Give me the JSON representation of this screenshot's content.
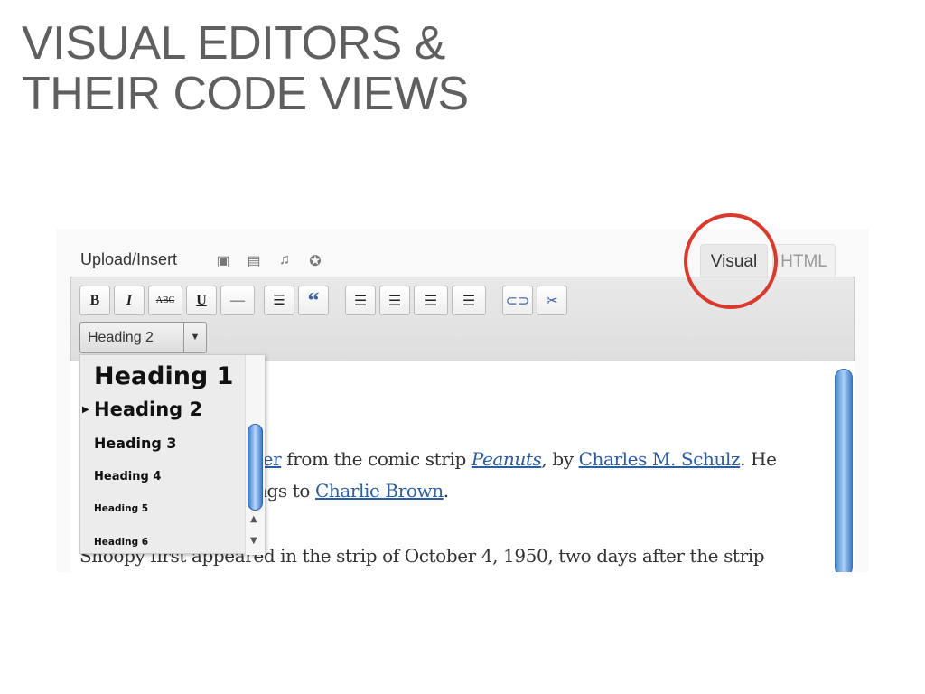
{
  "slide": {
    "title_line1": "VISUAL EDITORS &",
    "title_line2": "THEIR CODE VIEWS"
  },
  "editor": {
    "upload_label": "Upload/Insert",
    "upload_icons": [
      "image-icon",
      "gallery-icon",
      "music-icon",
      "media-icon"
    ],
    "tabs": [
      {
        "label": "Visual",
        "active": true
      },
      {
        "label": "HTML",
        "active": false
      }
    ],
    "toolbar": {
      "bold": "B",
      "italic": "I",
      "strike": "ABC",
      "underline": "U",
      "hr": "—",
      "quote": "“"
    },
    "format_select": {
      "value": "Heading 2"
    },
    "format_options": [
      "Heading 1",
      "Heading 2",
      "Heading 3",
      "Heading 4",
      "Heading 5",
      "Heading 6"
    ],
    "content": {
      "l1_a": "ter",
      "l1_b": " from the comic strip ",
      "l1_c": "Peanuts",
      "l1_d": ", by ",
      "l1_e": "Charles M. Schulz",
      "l1_f": ". He",
      "l2_a": "ngs to ",
      "l2_b": "Charlie Brown",
      "l2_c": ".",
      "l3": "Snoopy first appeared in the strip of October 4, 1950, two days after the strip"
    },
    "highlight_color": "#d83a2e"
  }
}
